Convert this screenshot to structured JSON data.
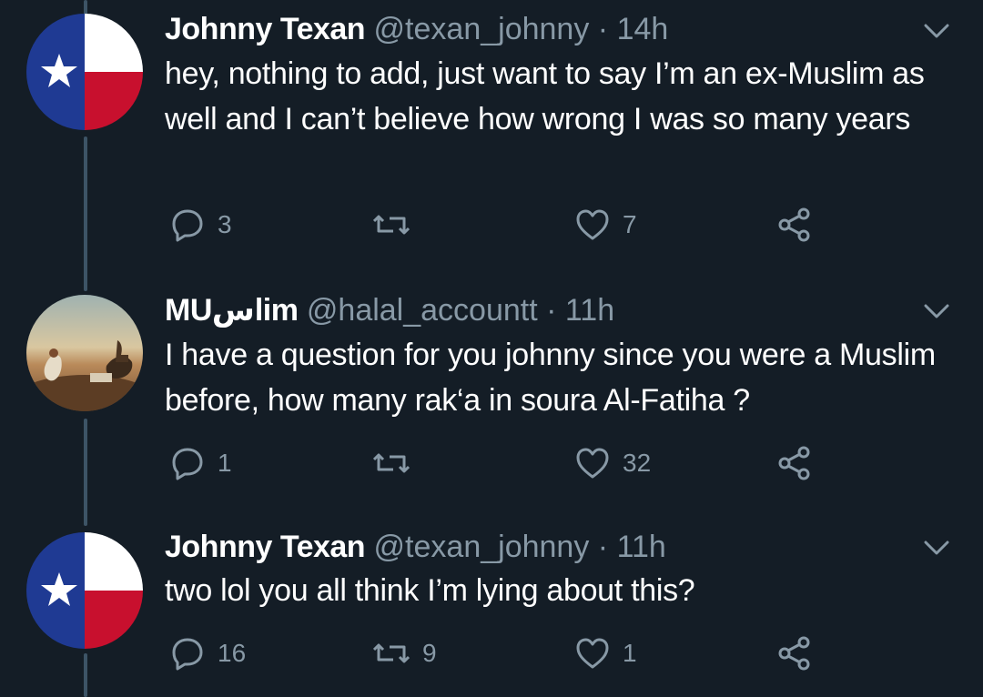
{
  "tweets": [
    {
      "name": "Johnny Texan",
      "handle": "@texan_johnny",
      "sep": "·",
      "time": "14h",
      "text": "hey, nothing to add, just want to say I’m an ex-Muslim as well and I can’t believe how wrong I was so many years",
      "replies": "3",
      "retweets": "",
      "likes": "7",
      "avatar": "texas-flag-avatar"
    },
    {
      "name": "MUسlim",
      "handle": "@halal_accountt",
      "sep": "·",
      "time": "11h",
      "text": "I have a question for you johnny since you were a Muslim before, how many rak‘a in soura Al-Fatiha ?",
      "replies": "1",
      "retweets": "",
      "likes": "32",
      "avatar": "desert-painting-avatar"
    },
    {
      "name": "Johnny Texan",
      "handle": "@texan_johnny",
      "sep": "·",
      "time": "11h",
      "text": "two lol you all think I’m lying about this?",
      "replies": "16",
      "retweets": "9",
      "likes": "1",
      "avatar": "texas-flag-avatar"
    }
  ],
  "colors": {
    "background": "#141d26",
    "secondary_text": "#8899a6",
    "thread_line": "#3d5466",
    "texas_blue": "#1f3a93",
    "texas_red": "#c8102e"
  }
}
